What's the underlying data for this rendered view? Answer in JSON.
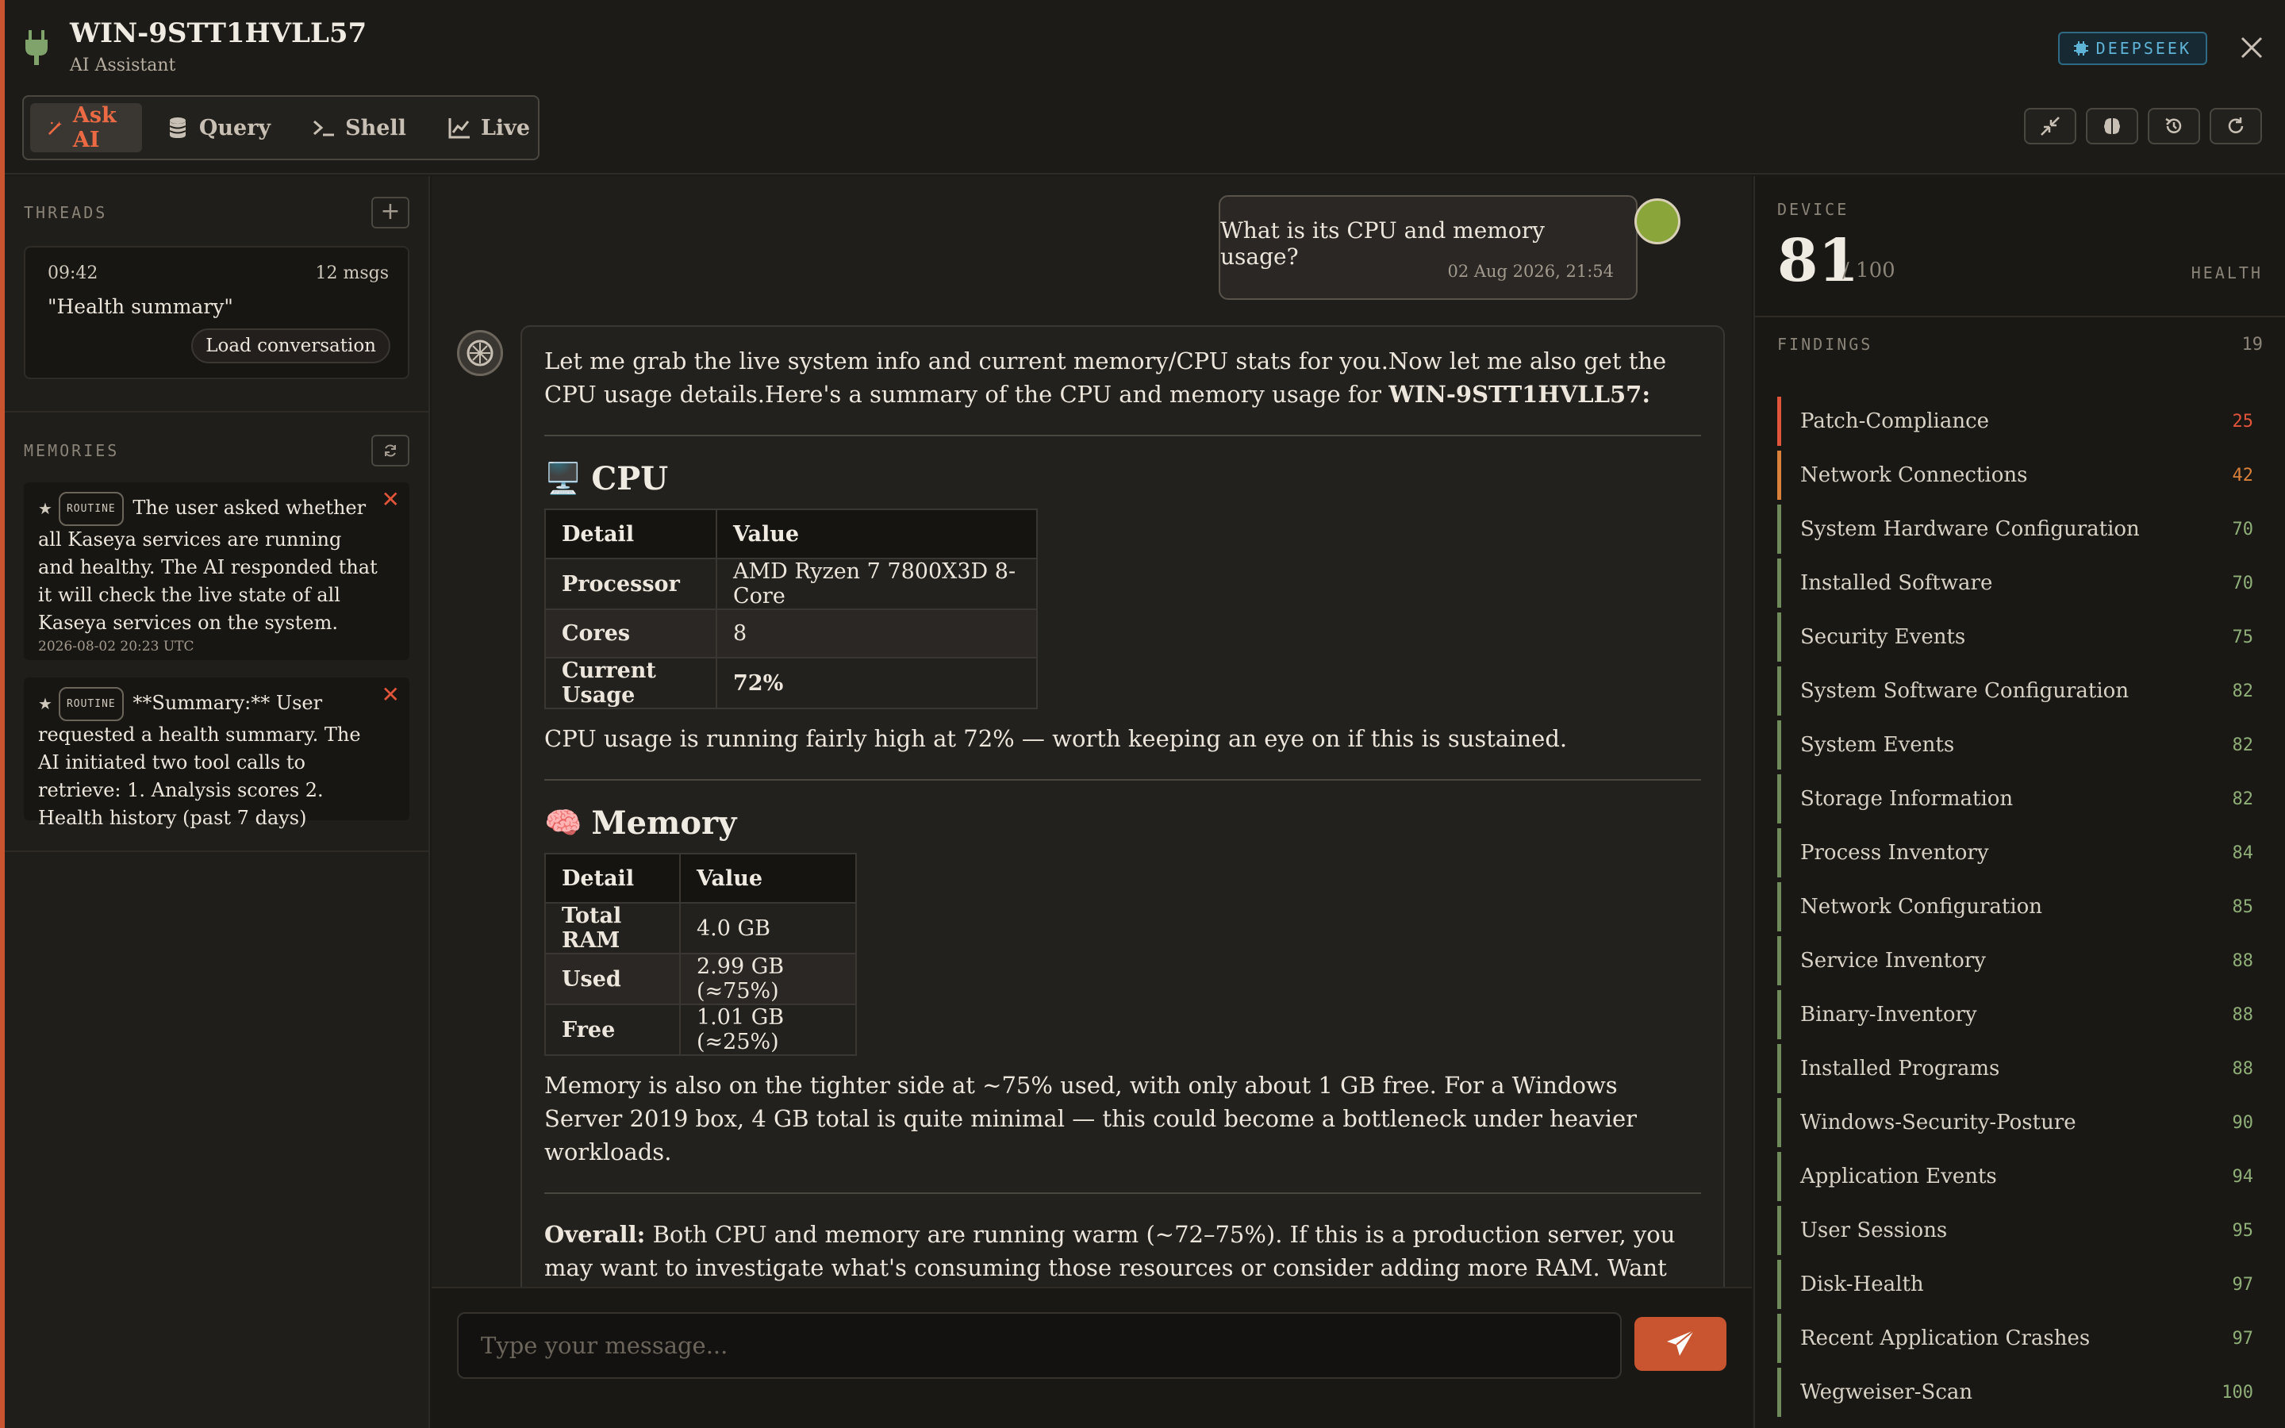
{
  "header": {
    "host": "WIN-9STT1HVLL57",
    "subtitle": "AI Assistant",
    "modes": [
      "Ask AI",
      "Query",
      "Shell",
      "Live"
    ],
    "provider": "DEEPSEEK"
  },
  "threads": {
    "label": "THREADS",
    "items": [
      {
        "time": "09:42",
        "count": "12 msgs",
        "title": "\"Health summary\"",
        "load_label": "Load conversation"
      }
    ]
  },
  "memories": {
    "label": "MEMORIES",
    "tag": "ROUTINE",
    "items": [
      {
        "text": "The user asked whether all Kaseya services are running and healthy. The AI responded that it will check the live state of all Kaseya services on the system.",
        "date": "2026-08-02 20:23 UTC"
      },
      {
        "text": "**Summary:** User requested a health summary. The AI initiated two tool calls to retrieve: 1. Analysis scores 2. Health history (past 7 days)",
        "date": ""
      }
    ]
  },
  "chat": {
    "user_message": "What is its CPU and memory usage?",
    "user_time": "02 Aug 2026, 21:54",
    "ai": {
      "intro": "Let me grab the live system info and current memory/CPU stats for you.Now let me also get the CPU usage details.Here's a summary of the CPU and memory usage for ",
      "intro_host": "WIN-9STT1HVLL57",
      "intro_end": ":",
      "cpu_heading": "CPU",
      "cpu_emoji": "🖥️",
      "table_headers": [
        "Detail",
        "Value"
      ],
      "cpu_rows": [
        {
          "k": "Processor",
          "v": "AMD Ryzen 7 7800X3D 8-Core"
        },
        {
          "k": "Cores",
          "v": "8"
        },
        {
          "k": "Current Usage",
          "v": "72%"
        }
      ],
      "cpu_note": "CPU usage is running fairly high at 72% — worth keeping an eye on if this is sustained.",
      "mem_heading": "Memory",
      "mem_emoji": "🧠",
      "mem_rows": [
        {
          "k": "Total RAM",
          "v": "4.0 GB"
        },
        {
          "k": "Used",
          "v": "2.99 GB (≈75%)"
        },
        {
          "k": "Free",
          "v": "1.01 GB (≈25%)"
        }
      ],
      "mem_note": "Memory is also on the tighter side at ~75% used, with only about 1 GB free. For a Windows Server 2019 box, 4 GB total is quite minimal — this could become a bottleneck under heavier workloads.",
      "overall_label": "Overall:",
      "overall_text": " Both CPU and memory are running warm (~72–75%). If this is a production server, you may want to investigate what's consuming those resources or consider adding more RAM. Want me to dig into which processes are using the most CPU or memory?"
    }
  },
  "composer": {
    "placeholder": "Type your message..."
  },
  "device": {
    "label": "DEVICE",
    "score": "81",
    "max": "/ 100",
    "health_label": "HEALTH",
    "findings_label": "FINDINGS",
    "findings_count": "19",
    "findings": [
      {
        "name": "Patch-Compliance",
        "score": "25",
        "color": "#e0553a"
      },
      {
        "name": "Network Connections",
        "score": "42",
        "color": "#d9803a"
      },
      {
        "name": "System Hardware Configuration",
        "score": "70",
        "color": "#6e8a5a"
      },
      {
        "name": "Installed Software",
        "score": "70",
        "color": "#6e8a5a"
      },
      {
        "name": "Security Events",
        "score": "75",
        "color": "#6e8a5a"
      },
      {
        "name": "System Software Configuration",
        "score": "82",
        "color": "#6e8a5a"
      },
      {
        "name": "System Events",
        "score": "82",
        "color": "#6e8a5a"
      },
      {
        "name": "Storage Information",
        "score": "82",
        "color": "#6e8a5a"
      },
      {
        "name": "Process Inventory",
        "score": "84",
        "color": "#6e8a5a"
      },
      {
        "name": "Network Configuration",
        "score": "85",
        "color": "#6e8a5a"
      },
      {
        "name": "Service Inventory",
        "score": "88",
        "color": "#6e8a5a"
      },
      {
        "name": "Binary-Inventory",
        "score": "88",
        "color": "#6e8a5a"
      },
      {
        "name": "Installed Programs",
        "score": "88",
        "color": "#6e8a5a"
      },
      {
        "name": "Windows-Security-Posture",
        "score": "90",
        "color": "#6e8a5a"
      },
      {
        "name": "Application Events",
        "score": "94",
        "color": "#6e8a5a"
      },
      {
        "name": "User Sessions",
        "score": "95",
        "color": "#6e8a5a"
      },
      {
        "name": "Disk-Health",
        "score": "97",
        "color": "#6e8a5a"
      },
      {
        "name": "Recent Application Crashes",
        "score": "97",
        "color": "#6e8a5a"
      },
      {
        "name": "Wegweiser-Scan",
        "score": "100",
        "color": "#6e8a5a"
      }
    ]
  }
}
